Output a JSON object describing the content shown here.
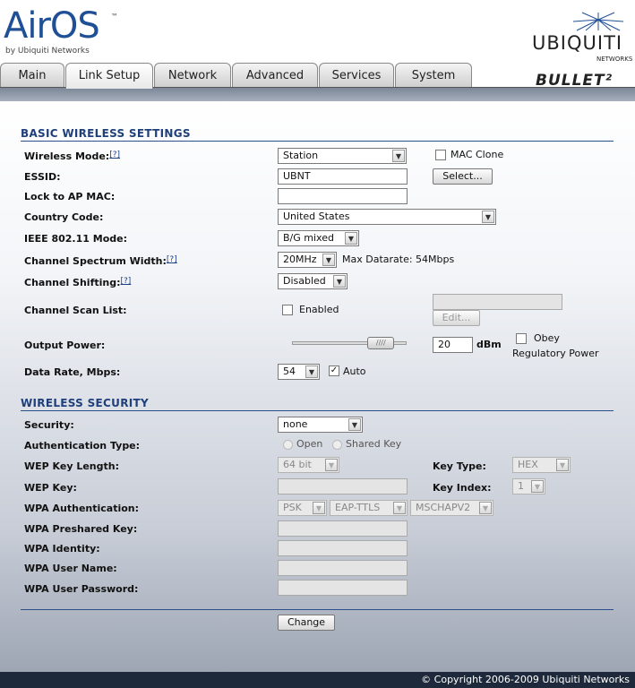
{
  "brand": {
    "airos_logo": "AirOS",
    "airos_tm": "™",
    "airos_by": "by Ubiquiti Networks",
    "ubnt_logo": "UBIQUITI",
    "ubnt_sub": "NETWORKS",
    "product_logo": "BULLET²"
  },
  "tabs": [
    {
      "label": "Main"
    },
    {
      "label": "Link Setup"
    },
    {
      "label": "Network"
    },
    {
      "label": "Advanced"
    },
    {
      "label": "Services"
    },
    {
      "label": "System"
    }
  ],
  "active_tab": "Link Setup",
  "basic": {
    "title": "BASIC WIRELESS SETTINGS",
    "help_marker": "[?]",
    "wireless_mode": {
      "label": "Wireless Mode:",
      "value": "Station"
    },
    "mac_clone": {
      "label": "MAC Clone",
      "checked": false
    },
    "essid": {
      "label": "ESSID:",
      "value": "UBNT"
    },
    "select_button": "Select...",
    "lock_ap_mac": {
      "label": "Lock to AP MAC:",
      "value": ""
    },
    "country_code": {
      "label": "Country Code:",
      "value": "United States"
    },
    "ieee_mode": {
      "label": "IEEE 802.11 Mode:",
      "value": "B/G mixed"
    },
    "channel_width": {
      "label": "Channel Spectrum Width:",
      "value": "20MHz",
      "max_datarate": "Max Datarate: 54Mbps"
    },
    "channel_shifting": {
      "label": "Channel Shifting:",
      "value": "Disabled"
    },
    "channel_scan": {
      "label": "Channel Scan List:",
      "enabled_label": "Enabled",
      "enabled": false,
      "list_value": "",
      "edit_button": "Edit..."
    },
    "output_power": {
      "label": "Output Power:",
      "value": "20",
      "unit": "dBm",
      "obey_label": "Obey",
      "regulatory_label": "Regulatory Power",
      "obey_checked": false,
      "slider_fraction": 0.86
    },
    "data_rate": {
      "label": "Data Rate, Mbps:",
      "value": "54",
      "auto_label": "Auto",
      "auto_checked": true
    }
  },
  "security": {
    "title": "WIRELESS SECURITY",
    "security": {
      "label": "Security:",
      "value": "none"
    },
    "auth_type": {
      "label": "Authentication Type:",
      "open": "Open",
      "shared": "Shared Key"
    },
    "wep_key_length": {
      "label": "WEP Key Length:",
      "value": "64 bit"
    },
    "key_type": {
      "label": "Key Type:",
      "value": "HEX"
    },
    "wep_key": {
      "label": "WEP Key:",
      "value": ""
    },
    "key_index": {
      "label": "Key Index:",
      "value": "1"
    },
    "wpa_auth": {
      "label": "WPA Authentication:",
      "values": [
        "PSK",
        "EAP-TTLS",
        "MSCHAPV2"
      ]
    },
    "wpa_psk": {
      "label": "WPA Preshared Key:",
      "value": ""
    },
    "wpa_identity": {
      "label": "WPA Identity:",
      "value": ""
    },
    "wpa_user": {
      "label": "WPA User Name:",
      "value": ""
    },
    "wpa_password": {
      "label": "WPA User Password:",
      "value": ""
    }
  },
  "change_button": "Change",
  "footer": {
    "copyright": "© Copyright 2006-2009 Ubiquiti Networks"
  },
  "colors": {
    "section_title": "#1f3f7a",
    "footer_bg": "#1e2a3b",
    "brand_blue": "#1f4f95"
  }
}
